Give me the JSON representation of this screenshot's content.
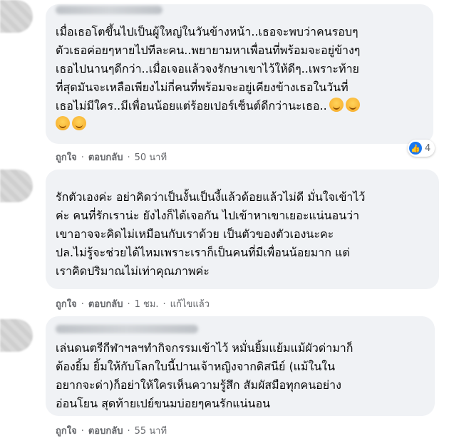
{
  "comments": [
    {
      "text": "เมื่อเธอโตขึ้นไปเป็นผู้ใหญ่ในวันข้างหน้า..เธอจะพบว่าคนรอบๆ\nตัวเธอค่อยๆหายไปทีละคน..พยายามหาเพื่อนที่พร้อมจะอยู่ข้างๆ\nเธอไปนานๆดีกว่า..เมื่อเจอแล้วจงรักษาเขาไว้ให้ดีๆ..เพราะท้าย\nที่สุดมันจะเหลือเพียงไม่กี่คนที่พร้อมจะอยู่เคียงข้างเธอในวันที่\nเธอไม่มีใคร..มีเพื่อนน้อยแต่ร้อยเปอร์เซ็นต์ดีกว่านะเธอ..",
      "like": "ถูกใจ",
      "reply": "ตอบกลับ",
      "time": "50 นาที",
      "reaction_count": "4",
      "reaction_icon": "thumbs-up-icon"
    },
    {
      "text": "รักตัวเองค่ะ อย่าคิดว่าเป็นงั้นเป็นงี้แล้วด้อยแล้วไม่ดี มั่นใจเข้าไว้\nค่ะ คนที่รักเราน่ะ ยังไงก็ได้เจอกัน ไปเข้าหาเขาเยอะแน่นอนว่า\nเขาอาจจะคิดไม่เหมือนกับเราด้วย เป็นตัวของตัวเองนะคะ\nปล.ไม่รู้จะช่วยได้ไหมเพราะเราก็เป็นคนที่มีเพื่อนน้อยมาก แต่\nเราคิดปริมาณไม่เท่าคุณภาพค่ะ",
      "like": "ถูกใจ",
      "reply": "ตอบกลับ",
      "time": "1 ชม.",
      "edited": "แก้ไขแล้ว"
    },
    {
      "text": "เล่นดนตรีกีฬาฯลฯทำกิจกรรมเข้าไว้ หมั่นยิ้มแย้มแม้ผัวด่ามาก็\nต้องยิ้ม ยิ้มให้กับโลกใบนี้ปานเจ้าหญิงจากดิสนีย์ (แม้ในใน\nอยากจะด่า)ก็อย่าให้ใครเห็นความรู้สึก สัมผัสมือทุกคนอย่าง\nอ่อนโยน สุดท้ายเปย์ขนมบ่อยๆคนรักแน่นอน",
      "like": "ถูกใจ",
      "reply": "ตอบกลับ",
      "time": "55 นาที"
    }
  ],
  "colors": {
    "bubble": "#f0f2f5",
    "secondary_text": "#65676b",
    "like_blue": "#1877f2"
  }
}
